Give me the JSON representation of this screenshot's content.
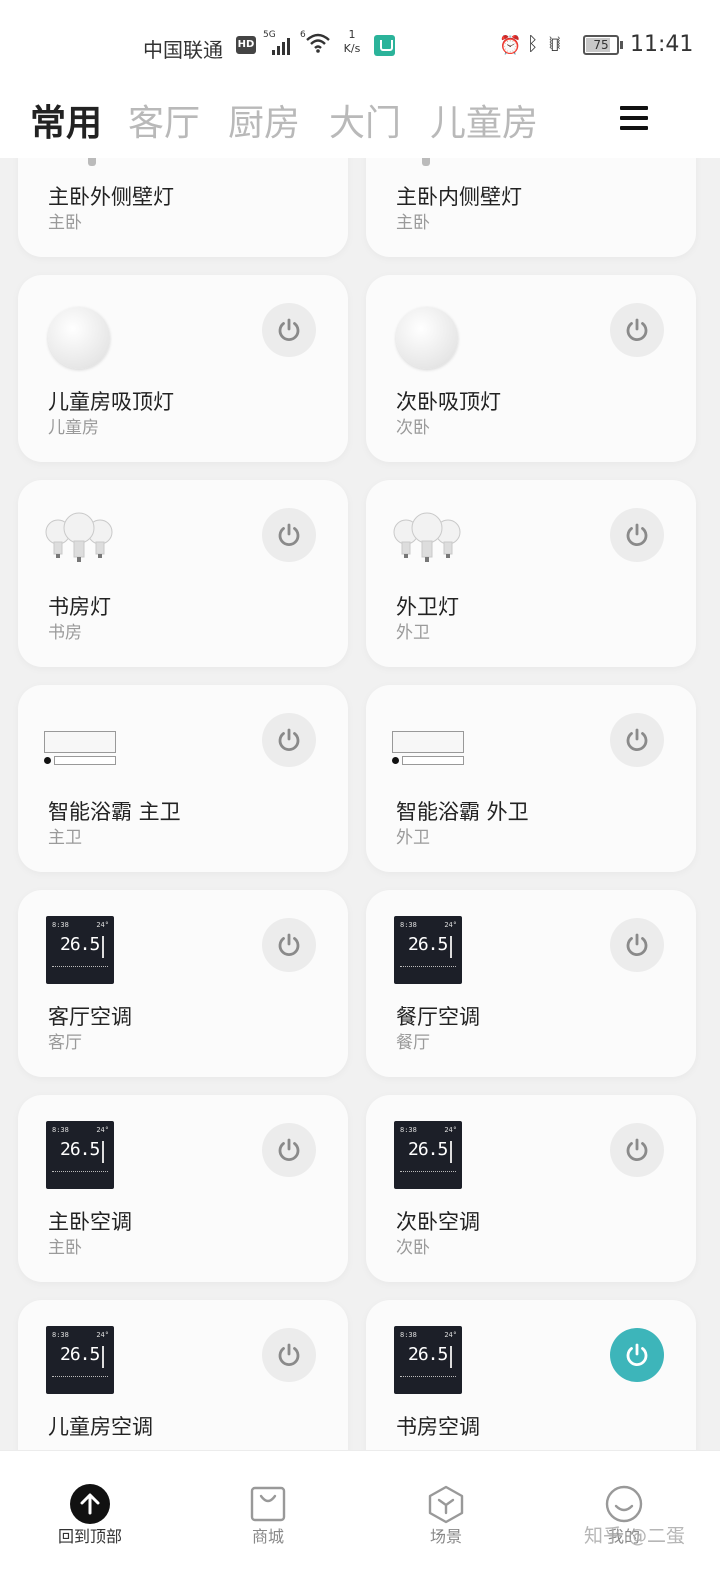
{
  "status_bar": {
    "carrier": "中国联通",
    "hd_badge": "HD",
    "network": "5G",
    "wifi_label": "6",
    "speed_value": "1",
    "speed_unit": "K/s",
    "battery": "75",
    "time": "11:41"
  },
  "tabs": [
    {
      "label": "常用",
      "active": true
    },
    {
      "label": "客厅",
      "active": false
    },
    {
      "label": "厨房",
      "active": false
    },
    {
      "label": "大门",
      "active": false
    },
    {
      "label": "儿童房",
      "active": false
    }
  ],
  "devices": [
    {
      "name": "主卧外侧壁灯",
      "room": "主卧",
      "icon": "wall-lamp-icon",
      "power": "off"
    },
    {
      "name": "主卧内侧壁灯",
      "room": "主卧",
      "icon": "wall-lamp-icon",
      "power": "off"
    },
    {
      "name": "儿童房吸顶灯",
      "room": "儿童房",
      "icon": "ceiling-light-icon",
      "power": "off"
    },
    {
      "name": "次卧吸顶灯",
      "room": "次卧",
      "icon": "ceiling-light-icon",
      "power": "off"
    },
    {
      "name": "书房灯",
      "room": "书房",
      "icon": "bulbs-icon",
      "power": "off"
    },
    {
      "name": "外卫灯",
      "room": "外卫",
      "icon": "bulbs-icon",
      "power": "off"
    },
    {
      "name": "智能浴霸 主卫",
      "room": "主卫",
      "icon": "bath-heater-icon",
      "power": "off"
    },
    {
      "name": "智能浴霸 外卫",
      "room": "外卫",
      "icon": "bath-heater-icon",
      "power": "off"
    },
    {
      "name": "客厅空调",
      "room": "客厅",
      "icon": "thermostat-icon",
      "power": "off"
    },
    {
      "name": "餐厅空调",
      "room": "餐厅",
      "icon": "thermostat-icon",
      "power": "off"
    },
    {
      "name": "主卧空调",
      "room": "主卧",
      "icon": "thermostat-icon",
      "power": "off"
    },
    {
      "name": "次卧空调",
      "room": "次卧",
      "icon": "thermostat-icon",
      "power": "off"
    },
    {
      "name": "儿童房空调",
      "room": "",
      "icon": "thermostat-icon",
      "power": "off"
    },
    {
      "name": "书房空调",
      "room": "",
      "icon": "thermostat-icon",
      "power": "on"
    }
  ],
  "thermostat_display": {
    "temp": "26.5",
    "clock": "8:38",
    "setpoint": "24°"
  },
  "bottom_nav": [
    {
      "label": "回到顶部",
      "icon": "arrow-up-icon"
    },
    {
      "label": "商城",
      "icon": "shop-bag-icon"
    },
    {
      "label": "场景",
      "icon": "scene-cube-icon"
    },
    {
      "label": "我的",
      "icon": "smile-icon"
    }
  ],
  "watermark": "知乎 @二蛋",
  "colors": {
    "power_on": "#3db5ba",
    "power_off": "#ececec",
    "background": "#f1f1f1"
  }
}
